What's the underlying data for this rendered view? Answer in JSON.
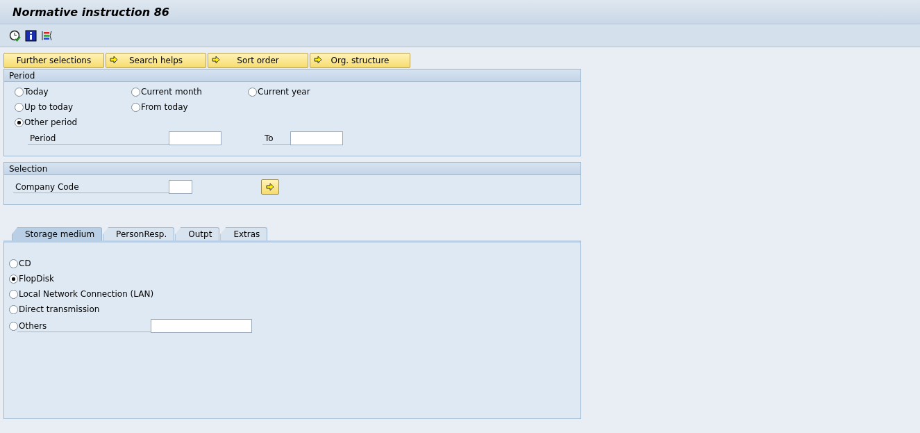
{
  "window": {
    "title": "Normative instruction 86"
  },
  "toolbar_buttons": [
    {
      "kind": "execute"
    },
    {
      "kind": "info"
    },
    {
      "kind": "layout"
    }
  ],
  "buttons": [
    {
      "label": "Further selections",
      "kind": "plain"
    },
    {
      "label": "Search helps",
      "kind": "arrow"
    },
    {
      "label": "Sort order",
      "kind": "arrow"
    },
    {
      "label": "Org. structure",
      "kind": "arrow"
    }
  ],
  "period": {
    "title": "Period",
    "rows": [
      [
        {
          "label": "Today",
          "selected": false
        },
        {
          "label": "Current month",
          "selected": false
        },
        {
          "label": "Current year",
          "selected": false
        }
      ],
      [
        {
          "label": "Up to today",
          "selected": false
        },
        {
          "label": "From today",
          "selected": false
        }
      ],
      [
        {
          "label": "Other period",
          "selected": true
        }
      ]
    ],
    "from_label": "Period",
    "to_label": "To"
  },
  "selection": {
    "title": "Selection",
    "company_code_label": "Company Code"
  },
  "tabs": [
    {
      "label": "Storage medium",
      "selected": true
    },
    {
      "label": "PersonResp.",
      "selected": false
    },
    {
      "label": "Outpt",
      "selected": false
    },
    {
      "label": "Extras",
      "selected": false
    }
  ],
  "storage_options": [
    {
      "label": "CD",
      "selected": false,
      "kind": "plain"
    },
    {
      "label": "FlopDisk",
      "selected": true,
      "kind": "plain"
    },
    {
      "label": "Local Network Connection (LAN)",
      "selected": false,
      "kind": "plain"
    },
    {
      "label": "Direct transmission",
      "selected": false,
      "kind": "plain"
    },
    {
      "label": "Others",
      "selected": false,
      "kind": "input"
    }
  ]
}
